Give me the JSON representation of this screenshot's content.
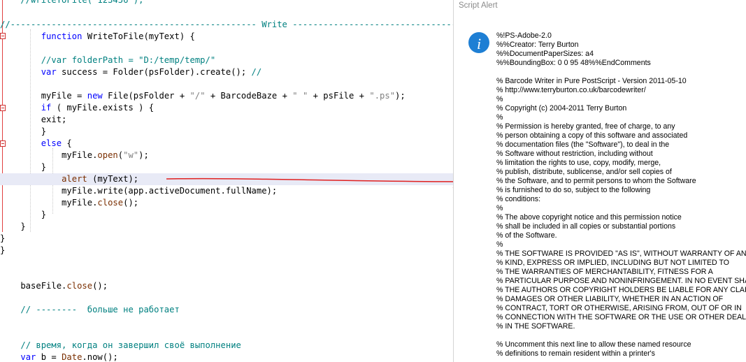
{
  "editor": {
    "lines": [
      [
        {
          "t": "    //writeToFile(\"123456\");",
          "c": "cm"
        }
      ],
      [
        {
          "t": "//------------------------------------------------ Write ---------------------------------------------------",
          "c": "cm"
        }
      ],
      [
        {
          "t": "        ",
          "c": "pl"
        },
        {
          "t": "function",
          "c": "kw"
        },
        {
          "t": " WriteToFile(myText) {",
          "c": "pl"
        }
      ],
      [],
      [
        {
          "t": "        ",
          "c": "pl"
        },
        {
          "t": "//var folderPath = \"D:/temp/temp/\"",
          "c": "cm"
        }
      ],
      [
        {
          "t": "        ",
          "c": "pl"
        },
        {
          "t": "var",
          "c": "kw"
        },
        {
          "t": " success = Folder(psFolder).create(); ",
          "c": "pl"
        },
        {
          "t": "//",
          "c": "cm"
        }
      ],
      [],
      [
        {
          "t": "        myFile = ",
          "c": "pl"
        },
        {
          "t": "new",
          "c": "kw"
        },
        {
          "t": " File(psFolder + ",
          "c": "pl"
        },
        {
          "t": "\"/\"",
          "c": "st"
        },
        {
          "t": " + BarcodeBaze + ",
          "c": "pl"
        },
        {
          "t": "\" \"",
          "c": "st"
        },
        {
          "t": " + psFile + ",
          "c": "pl"
        },
        {
          "t": "\".ps\"",
          "c": "st"
        },
        {
          "t": ");",
          "c": "pl"
        }
      ],
      [
        {
          "t": "        ",
          "c": "pl"
        },
        {
          "t": "if",
          "c": "kw"
        },
        {
          "t": " ( myFile.exists ) {",
          "c": "pl"
        }
      ],
      [
        {
          "t": "        exit;",
          "c": "pl"
        }
      ],
      [
        {
          "t": "        }",
          "c": "pl"
        }
      ],
      [
        {
          "t": "        ",
          "c": "pl"
        },
        {
          "t": "else",
          "c": "kw"
        },
        {
          "t": " {",
          "c": "pl"
        }
      ],
      [
        {
          "t": "            myFile.",
          "c": "pl"
        },
        {
          "t": "open",
          "c": "fn"
        },
        {
          "t": "(",
          "c": "pl"
        },
        {
          "t": "\"w\"",
          "c": "st"
        },
        {
          "t": ");",
          "c": "pl"
        }
      ],
      [
        {
          "t": "        }",
          "c": "pl"
        }
      ],
      [
        {
          "t": "            ",
          "c": "pl"
        },
        {
          "t": "alert",
          "c": "fn"
        },
        {
          "t": " (myText);",
          "c": "pl"
        }
      ],
      [
        {
          "t": "            myFile.write(app.activeDocument.fullName);",
          "c": "pl"
        }
      ],
      [
        {
          "t": "            myFile.",
          "c": "pl"
        },
        {
          "t": "close",
          "c": "fn"
        },
        {
          "t": "();",
          "c": "pl"
        }
      ],
      [
        {
          "t": "        }",
          "c": "pl"
        }
      ],
      [
        {
          "t": "    }",
          "c": "pl"
        }
      ],
      [
        {
          "t": "}",
          "c": "pl"
        }
      ],
      [
        {
          "t": "}",
          "c": "pl"
        }
      ],
      [],
      [],
      [
        {
          "t": "    baseFile.",
          "c": "pl"
        },
        {
          "t": "close",
          "c": "fn"
        },
        {
          "t": "();",
          "c": "pl"
        }
      ],
      [],
      [
        {
          "t": "    ",
          "c": "pl"
        },
        {
          "t": "// --------  больше не работает",
          "c": "cm"
        }
      ],
      [],
      [],
      [
        {
          "t": "    ",
          "c": "pl"
        },
        {
          "t": "// время, когда он завершил своё выполнение",
          "c": "cm"
        }
      ],
      [
        {
          "t": "    ",
          "c": "pl"
        },
        {
          "t": "var",
          "c": "kw"
        },
        {
          "t": " b = ",
          "c": "pl"
        },
        {
          "t": "Date",
          "c": "fn"
        },
        {
          "t": ".now();",
          "c": "pl"
        }
      ]
    ]
  },
  "alert": {
    "title": "Script Alert",
    "icon": "info-icon",
    "message_lines": [
      "%!PS-Adobe-2.0",
      "%%Creator: Terry Burton",
      "%%DocumentPaperSizes: a4",
      "%%BoundingBox: 0 0 95 48%%EndComments",
      "",
      "% Barcode Writer in Pure PostScript - Version 2011-05-10",
      "% http://www.terryburton.co.uk/barcodewriter/",
      "%",
      "% Copyright (c) 2004-2011 Terry Burton",
      "%",
      "% Permission is hereby granted, free of charge, to any",
      "% person obtaining a copy of this software and associated",
      "% documentation files (the \"Software\"), to deal in the",
      "% Software without restriction, including without",
      "% limitation the rights to use, copy, modify, merge,",
      "% publish, distribute, sublicense, and/or sell copies of",
      "% the Software, and to permit persons to whom the Software",
      "% is furnished to do so, subject to the following",
      "% conditions:",
      "%",
      "% The above copyright notice and this permission notice",
      "% shall be included in all copies or substantial portions",
      "% of the Software.",
      "%",
      "% THE SOFTWARE IS PROVIDED \"AS IS\", WITHOUT WARRANTY OF ANY",
      "% KIND, EXPRESS OR IMPLIED, INCLUDING BUT NOT LIMITED TO",
      "% THE WARRANTIES OF MERCHANTABILITY, FITNESS FOR A",
      "% PARTICULAR PURPOSE AND NONINFRINGEMENT. IN NO EVENT SHALL",
      "% THE AUTHORS OR COPYRIGHT HOLDERS BE LIABLE FOR ANY CLAIM,",
      "% DAMAGES OR OTHER LIABILITY, WHETHER IN AN ACTION OF",
      "% CONTRACT, TORT OR OTHERWISE, ARISING FROM, OUT OF OR IN",
      "% CONNECTION WITH THE SOFTWARE OR THE USE OR OTHER DEALINGS",
      "% IN THE SOFTWARE.",
      "",
      "% Uncomment this next line to allow these named resource",
      "% definitions to remain resident within a printer's"
    ]
  },
  "colors": {
    "keyword": "#0000ff",
    "comment": "#008080",
    "string": "#808080",
    "method": "#7a2e00",
    "highlight_line": "#e8eaf6",
    "arrow": "#e02020",
    "info_icon": "#1e7fd4"
  }
}
